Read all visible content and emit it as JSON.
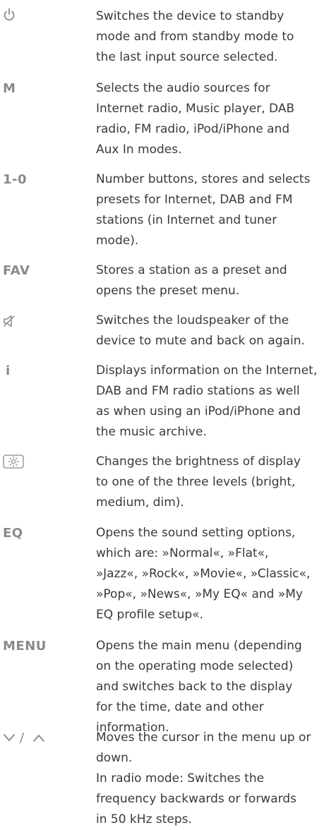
{
  "entries": [
    {
      "key_icon": "power-icon",
      "lines": [
        "Switches the device to standby",
        "mode and from standby mode to",
        "the last input source selected."
      ]
    },
    {
      "key": "M",
      "lines": [
        "Selects the audio sources for",
        "Internet radio, Music player, DAB",
        "radio, FM radio, iPod/iPhone and",
        "Aux In modes."
      ]
    },
    {
      "key": "1-0",
      "lines": [
        "Number buttons, stores and selects",
        "presets for Internet, DAB and FM",
        "stations (in Internet and tuner",
        "mode)."
      ]
    },
    {
      "key": "FAV",
      "lines": [
        "Stores a station as a preset and",
        "opens the preset menu."
      ]
    },
    {
      "key_icon": "mute-speaker-icon",
      "lines": [
        "Switches the loudspeaker of the",
        "device to mute and back on again."
      ]
    },
    {
      "key": "i",
      "lines": [
        "Displays information on the Internet,",
        "DAB and FM radio stations as well",
        "as when using an iPod/iPhone and",
        "the music archive."
      ]
    },
    {
      "key_icon": "brightness-button-icon",
      "lines": [
        "Changes the brightness of display",
        "to one of the three levels (bright,",
        "medium, dim)."
      ]
    },
    {
      "key": "EQ",
      "lines": [
        "Opens the sound setting options,",
        "which are: »Normal«, »Flat«,",
        "»Jazz«, »Rock«, »Movie«, »Classic«,",
        "»Pop«, »News«, »My EQ« and »My",
        "EQ profile setup«."
      ]
    },
    {
      "key": "MENU",
      "lines": [
        "Opens the main menu (depending",
        "on the operating mode selected)",
        "and switches back to the display",
        "for the time, date and other",
        "information."
      ]
    },
    {
      "key_icon": "down-up-arrows-icon",
      "key": "/",
      "lines": [
        "Moves the cursor in the menu up or",
        "down.",
        "In radio mode: Switches the",
        "frequency backwards or forwards",
        "in 50 kHz steps."
      ]
    }
  ]
}
